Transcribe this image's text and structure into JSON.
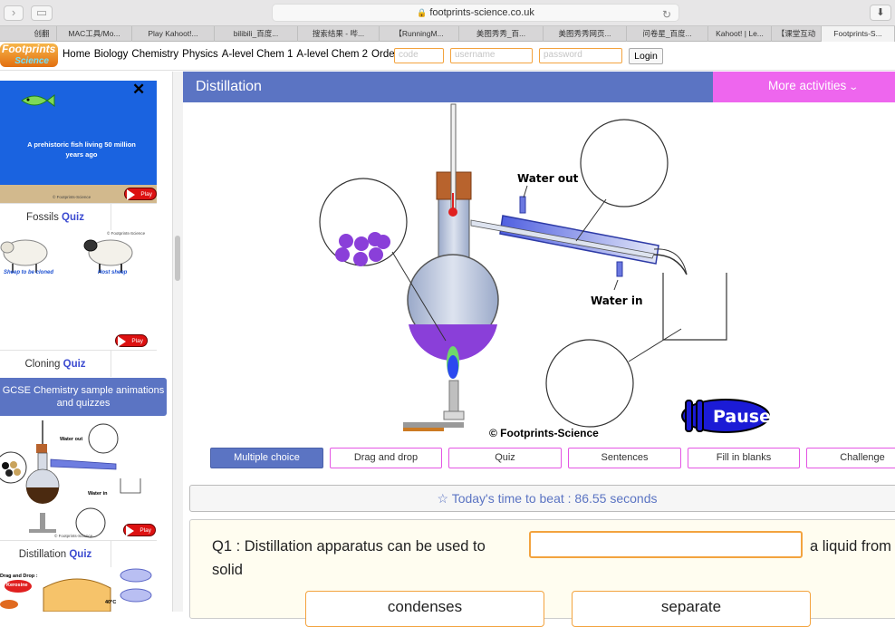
{
  "browser": {
    "url": "footprints-science.co.uk",
    "tabs": [
      "创翻",
      "MAC工具/Mo...",
      "Play Kahoot!...",
      "bilibili_百度...",
      "搜索结果 - 哔...",
      "【RunningM...",
      "美图秀秀_百...",
      "美图秀秀网页...",
      "问卷星_百度...",
      "Kahoot! | Le...",
      "【课堂互动",
      "Footprints-S..."
    ]
  },
  "site": {
    "logo_top": "Footprints",
    "logo_bottom": "Science",
    "nav": [
      "Home",
      "Biology",
      "Chemistry",
      "Physics",
      "A-level Chem 1",
      "A-level Chem 2",
      "Order"
    ],
    "login": {
      "code_placeholder": "code",
      "username_placeholder": "username",
      "password_placeholder": "password",
      "login_label": "Login"
    }
  },
  "sidebar": {
    "fish_caption": "A prehistoric fish living 50 million years ago",
    "copyright_small": "© Footprints-Science",
    "play_label": "Play",
    "fossils": {
      "name": "Fossils",
      "quiz": "Quiz"
    },
    "sheep_left": "Sheep to be cloned",
    "sheep_right": "Host sheep",
    "cloning": {
      "name": "Cloning",
      "quiz": "Quiz"
    },
    "category_button": "GCSE Chemistry sample animations and quizzes",
    "mini_water_out": "Water out",
    "mini_water_in": "Water in",
    "distillation": {
      "name": "Distillation",
      "quiz": "Quiz"
    },
    "bottom_drag": "Drag and Drop :",
    "bottom_kerosine": "Kerosine",
    "bottom_temp": "40°C"
  },
  "main": {
    "title": "Distillation",
    "more_activities": "More activities",
    "diagram": {
      "water_out": "Water out",
      "water_in": "Water in",
      "copyright": "© Footprints-Science",
      "pause": "Pause"
    },
    "activities": [
      "Multiple choice",
      "Drag and drop",
      "Quiz",
      "Sentences",
      "Fill in blanks",
      "Challenge"
    ],
    "time_to_beat": "Today's time to beat : 86.55 seconds",
    "question": {
      "prefix": "Q1 : Distillation apparatus can be used to",
      "suffix": "a liquid from",
      "line2": "solid",
      "options": [
        "condenses",
        "separate"
      ]
    }
  }
}
